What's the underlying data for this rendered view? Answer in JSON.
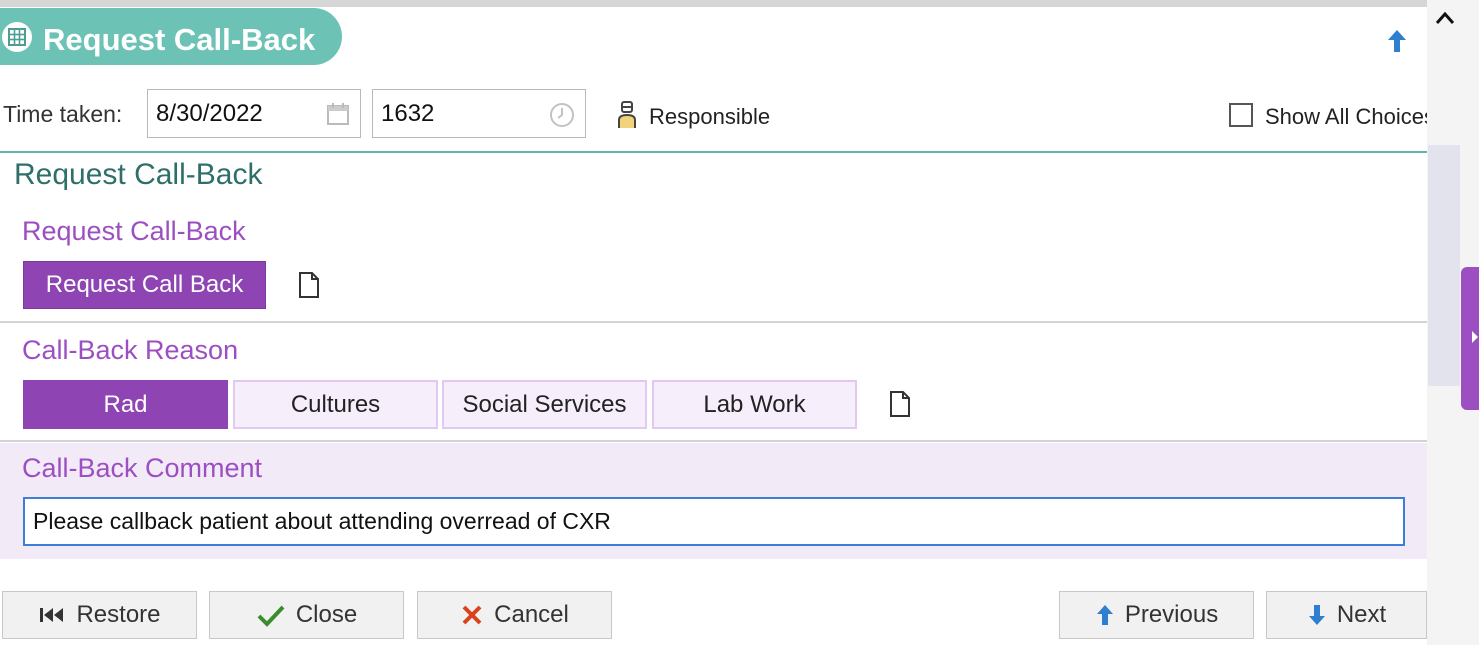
{
  "header": {
    "title": "Request Call-Back"
  },
  "time_row": {
    "label": "Time taken:",
    "date_value": "8/30/2022",
    "time_value": "1632",
    "responsible_label": "Responsible",
    "show_all_label": "Show All Choices",
    "show_all_checked": false
  },
  "section": {
    "title": "Request Call-Back",
    "request_label": "Request Call-Back",
    "request_button": "Request Call Back",
    "reason_label": "Call-Back Reason",
    "reasons": [
      {
        "label": "Rad",
        "selected": true
      },
      {
        "label": "Cultures",
        "selected": false
      },
      {
        "label": "Social Services",
        "selected": false
      },
      {
        "label": "Lab Work",
        "selected": false
      }
    ],
    "comment_label": "Call-Back Comment",
    "comment_value": "Please callback patient about attending overread of CXR"
  },
  "footer": {
    "restore": "Restore",
    "close": "Close",
    "cancel": "Cancel",
    "previous": "Previous",
    "next": "Next"
  },
  "colors": {
    "teal_header": "#6cc2b4",
    "purple_accent": "#8e44b3",
    "purple_text": "#9c4fc2",
    "section_title": "#2f6f6a",
    "input_focus": "#3d7fd8"
  },
  "icons": [
    "grid-icon",
    "arrow-up-icon",
    "chevron-up-icon",
    "calendar-icon",
    "clock-icon",
    "person-icon",
    "document-icon",
    "first-page-icon",
    "checkmark-icon",
    "x-icon",
    "arrow-down-icon"
  ]
}
